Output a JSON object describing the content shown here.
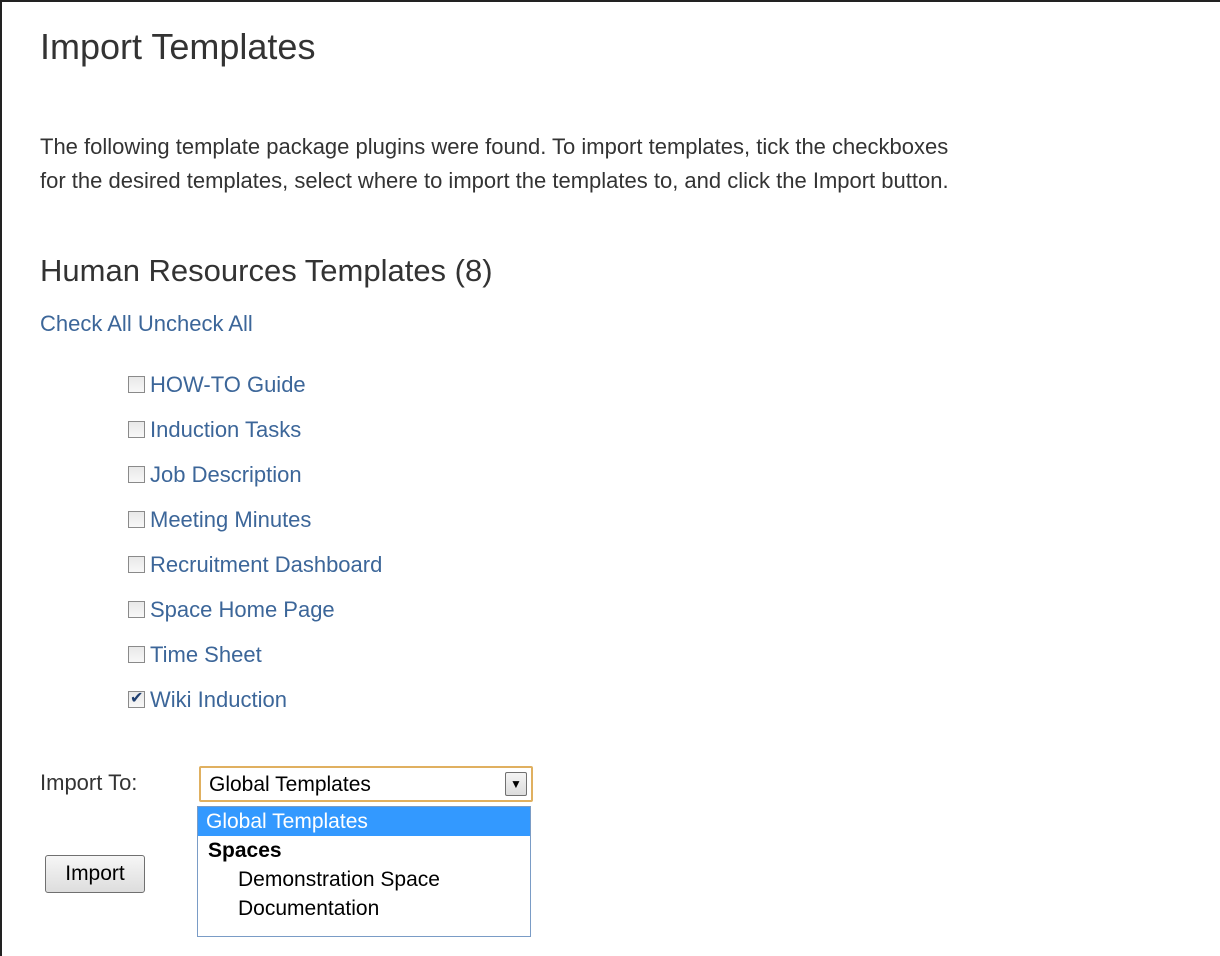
{
  "page": {
    "title": "Import Templates",
    "intro_line1": "The following template package plugins were found. To import templates, tick the checkboxes",
    "intro_line2": "for the desired templates, select where to import the templates to, and click the Import button."
  },
  "section": {
    "title": "Human Resources Templates (8)",
    "check_all": "Check All",
    "uncheck_all": "Uncheck All",
    "templates": [
      {
        "label": "HOW-TO Guide",
        "checked": false
      },
      {
        "label": "Induction Tasks",
        "checked": false
      },
      {
        "label": "Job Description",
        "checked": false
      },
      {
        "label": "Meeting Minutes",
        "checked": false
      },
      {
        "label": "Recruitment Dashboard",
        "checked": false
      },
      {
        "label": "Space Home Page",
        "checked": false
      },
      {
        "label": "Time Sheet",
        "checked": false
      },
      {
        "label": "Wiki Induction",
        "checked": true
      }
    ]
  },
  "import_to": {
    "label": "Import To:",
    "selected": "Global Templates",
    "options": {
      "global": "Global Templates",
      "group_label": "Spaces",
      "space1": "Demonstration Space",
      "space2": "Documentation"
    }
  },
  "import_button": "Import",
  "colors": {
    "link": "#3c6699",
    "selected_option_bg": "#3399ff",
    "select_focus_border": "#e0b060"
  }
}
